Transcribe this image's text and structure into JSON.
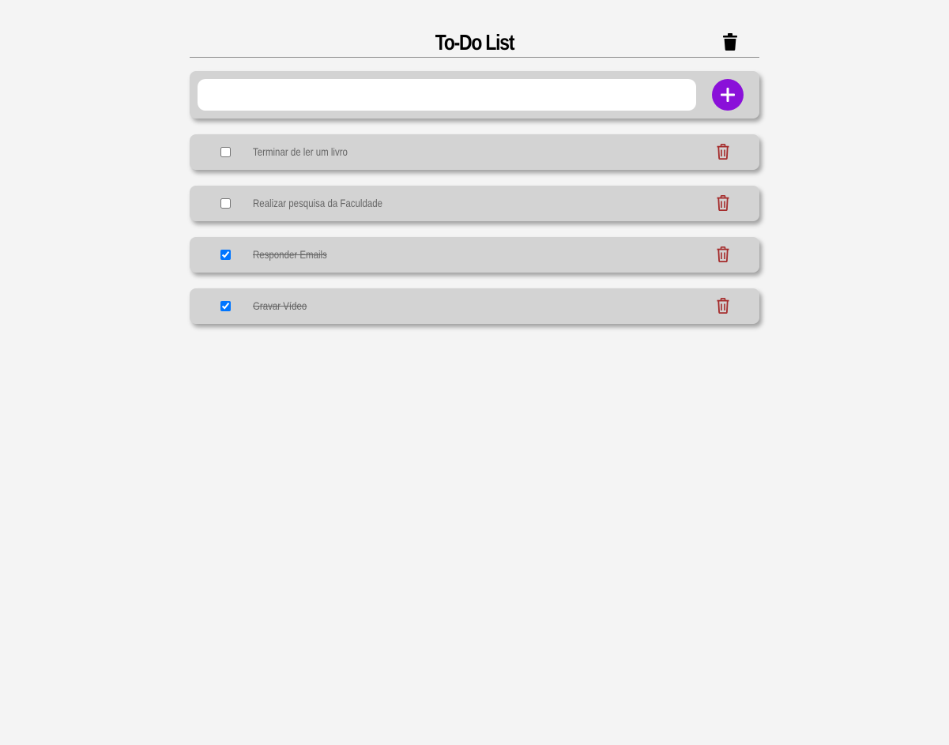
{
  "header": {
    "title": "To-Do List",
    "clear_icon": "trash-icon"
  },
  "new_task": {
    "value": "",
    "placeholder": "",
    "add_icon": "plus-icon"
  },
  "colors": {
    "accent": "#8a10d9",
    "delete": "#a52a2a",
    "card": "#d3d3d3",
    "background": "#f4f4f4"
  },
  "tasks": [
    {
      "label": "Terminar de ler um livro",
      "done": false
    },
    {
      "label": "Realizar pesquisa da Faculdade",
      "done": false
    },
    {
      "label": "Responder Emails",
      "done": true
    },
    {
      "label": "Gravar Vídeo",
      "done": true
    }
  ]
}
